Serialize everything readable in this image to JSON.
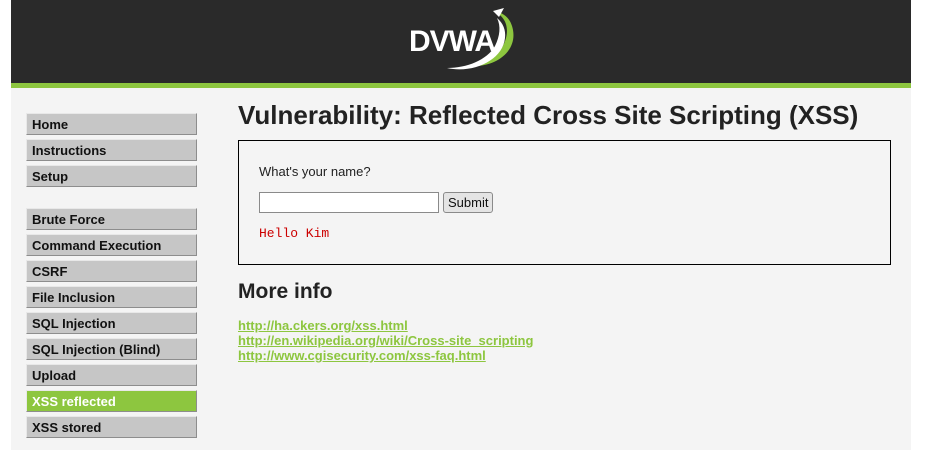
{
  "app": {
    "logo_text": "DVWA"
  },
  "colors": {
    "accent": "#8dc63f",
    "header_bg": "#2a2a2a",
    "page_bg": "#f4f4f4",
    "menu_bg": "#c6c6c6",
    "output_text": "#cc0000"
  },
  "sidebar": {
    "group1": [
      {
        "label": "Home"
      },
      {
        "label": "Instructions"
      },
      {
        "label": "Setup"
      }
    ],
    "group2": [
      {
        "label": "Brute Force"
      },
      {
        "label": "Command Execution"
      },
      {
        "label": "CSRF"
      },
      {
        "label": "File Inclusion"
      },
      {
        "label": "SQL Injection"
      },
      {
        "label": "SQL Injection (Blind)"
      },
      {
        "label": "Upload"
      },
      {
        "label": "XSS reflected",
        "selected": true
      },
      {
        "label": "XSS stored"
      }
    ]
  },
  "main": {
    "title": "Vulnerability: Reflected Cross Site Scripting (XSS)",
    "form": {
      "question": "What's your name?",
      "input_value": "",
      "input_placeholder": "",
      "submit_label": "Submit",
      "output": "Hello Kim"
    },
    "more_info": {
      "heading": "More info",
      "links": [
        "http://ha.ckers.org/xss.html",
        "http://en.wikipedia.org/wiki/Cross-site_scripting",
        "http://www.cgisecurity.com/xss-faq.html"
      ]
    }
  }
}
